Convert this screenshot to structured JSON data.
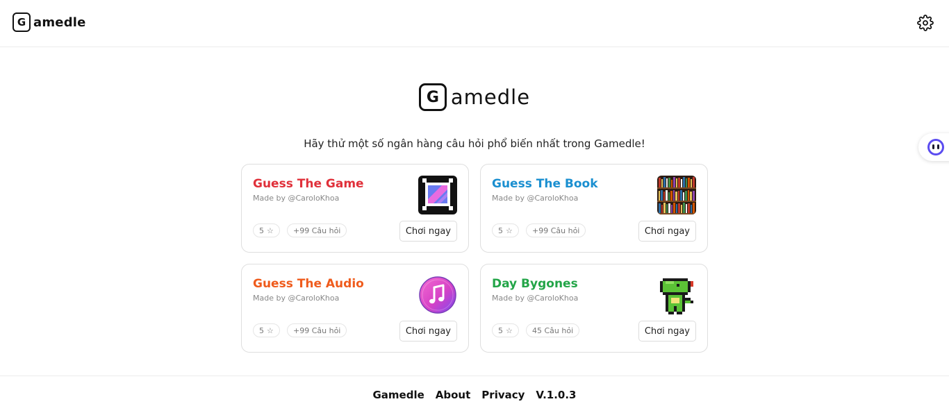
{
  "header": {
    "logo_letter": "G",
    "brand": "amedle",
    "settings_icon": "gear-icon"
  },
  "hero": {
    "logo_letter": "G",
    "brand": "amedle"
  },
  "subtitle": "Hãy thử một số ngân hàng câu hỏi phổ biến nhất trong Gamedle!",
  "cards": [
    {
      "title": "Guess The Game",
      "author": "Made by @CaroloKhoa",
      "stars": "5",
      "count": "+99 Câu hỏi",
      "play_label": "Chơi ngay",
      "title_color": "#e0303a",
      "thumb_icon": "retro-tv-icon"
    },
    {
      "title": "Guess The Book",
      "author": "Made by @CaroloKhoa",
      "stars": "5",
      "count": "+99 Câu hỏi",
      "play_label": "Chơi ngay",
      "title_color": "#1a8fd0",
      "thumb_icon": "bookshelf-icon"
    },
    {
      "title": "Guess The Audio",
      "author": "Made by @CaroloKhoa",
      "stars": "5",
      "count": "+99 Câu hỏi",
      "play_label": "Chơi ngay",
      "title_color": "#ef5b1c",
      "thumb_icon": "music-note-icon"
    },
    {
      "title": "Day Bygones",
      "author": "Made by @CaroloKhoa",
      "stars": "5",
      "count": "45 Câu hỏi",
      "play_label": "Chơi ngay",
      "title_color": "#23a548",
      "thumb_icon": "pixel-dinosaur-icon"
    }
  ],
  "footer": {
    "links": [
      "Gamedle",
      "About",
      "Privacy"
    ],
    "version": "V.1.0.3"
  },
  "side_widget_icon": "chat-assistant-icon"
}
